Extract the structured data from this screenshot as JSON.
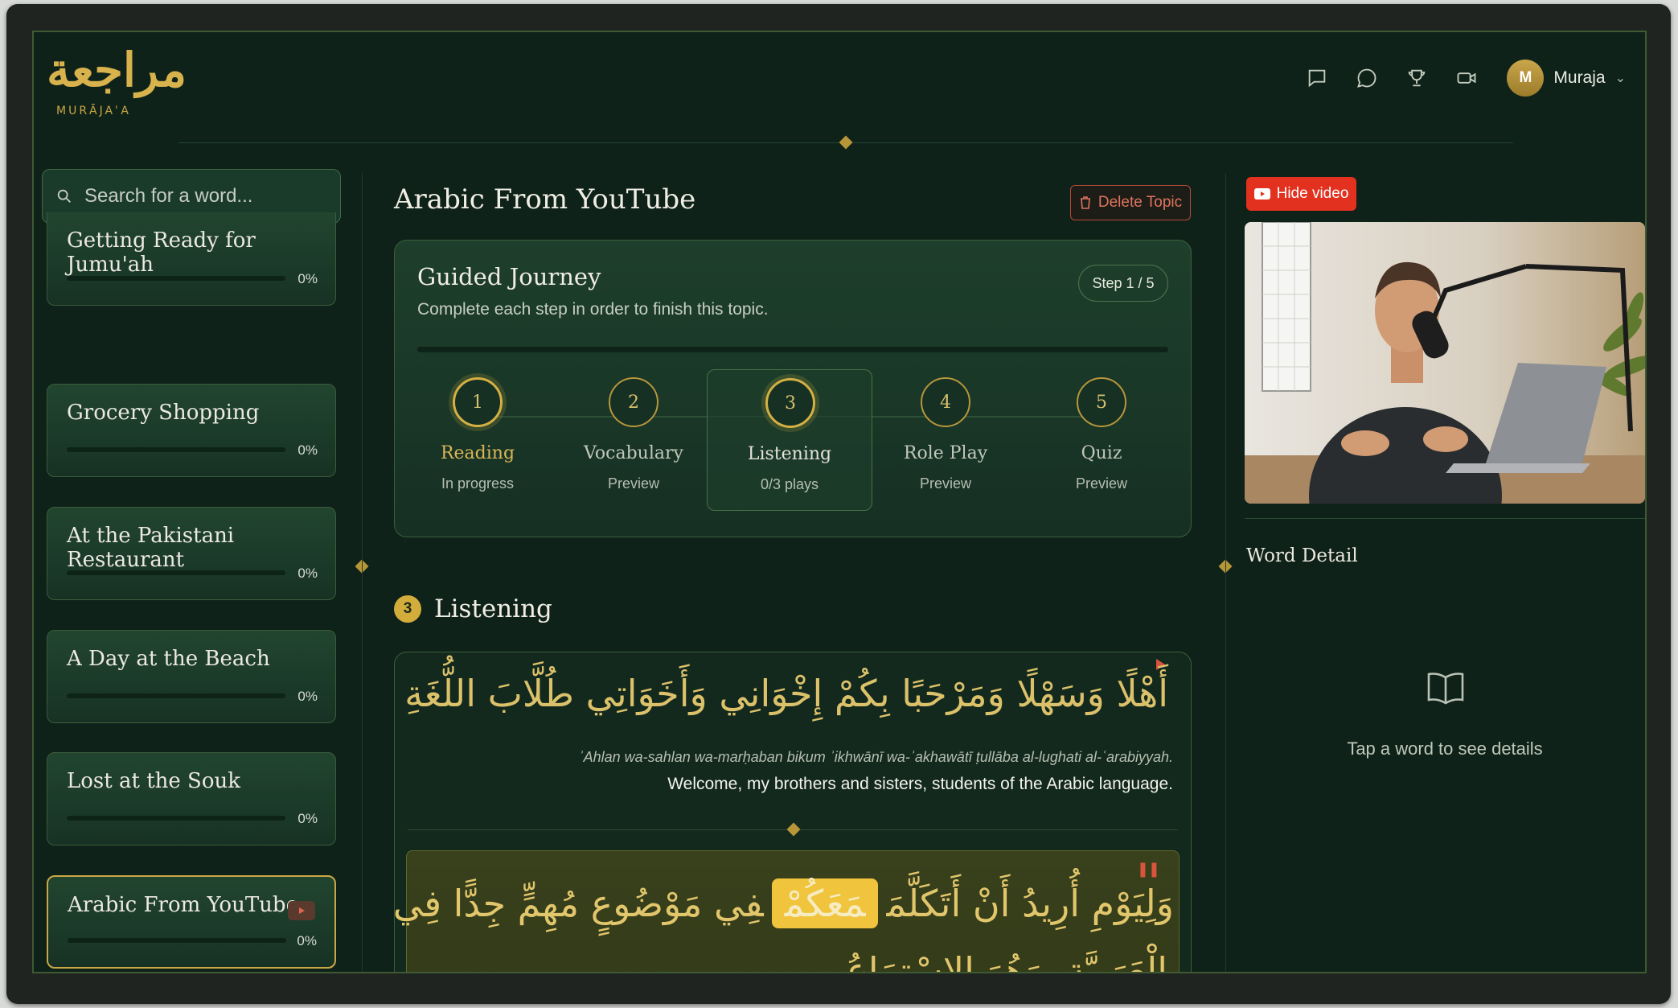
{
  "app": {
    "logo_arabic": "مراجعة",
    "logo_latin": "MURĀJAʿA"
  },
  "header": {
    "user_initial": "M",
    "user_name": "Muraja"
  },
  "sidebar": {
    "search_placeholder": "Search for a word...",
    "topics": [
      {
        "title": "Getting Ready for Jumu'ah",
        "progress": "0%"
      },
      {
        "title": "Grocery Shopping",
        "progress": "0%"
      },
      {
        "title": "At the Pakistani Restaurant",
        "progress": "0%"
      },
      {
        "title": "A Day at the Beach",
        "progress": "0%"
      },
      {
        "title": "Lost at the Souk",
        "progress": "0%"
      },
      {
        "title": "Arabic From YouTube",
        "progress": "0%",
        "active": true
      }
    ]
  },
  "main": {
    "title": "Arabic From YouTube",
    "delete_label": "Delete Topic",
    "journey": {
      "title": "Guided Journey",
      "subtitle": "Complete each step in order to finish this topic.",
      "step_indicator": "Step 1 / 5",
      "steps": [
        {
          "num": "1",
          "name": "Reading",
          "status": "In progress"
        },
        {
          "num": "2",
          "name": "Vocabulary",
          "status": "Preview"
        },
        {
          "num": "3",
          "name": "Listening",
          "status": "0/3 plays"
        },
        {
          "num": "4",
          "name": "Role Play",
          "status": "Preview"
        },
        {
          "num": "5",
          "name": "Quiz",
          "status": "Preview"
        }
      ]
    },
    "section": {
      "number": "3",
      "title": "Listening"
    },
    "listening": {
      "line1_arabic": "أَهْلًا وَسَهْلًا وَمَرْحَبًا بِكُمْ إِخْوَانِي وَأَخَوَاتِي طُلَّابَ اللُّغَةِ الْعَرَبِيَّةِ.",
      "line1_translit": "ʾAhlan wa-sahlan wa-marḥaban bikum ʾikhwānī wa-ʾakhawātī ṭullāba al-lughati al-ʿarabiyyah.",
      "line1_translation": "Welcome, my brothers and sisters, students of the Arabic language.",
      "line2_before": "وَلِيَوْمِ أُرِيدُ أَنْ أَتَكَلَّمَ",
      "line2_highlight": "مَعَكُمْ",
      "line2_after": "فِي مَوْضُوعٍ مُهِمٍّ جِدًّا فِي تَعَلُّمِ اللُّغَةِ",
      "line3": "الْعَرَبِيَّةِ، وَهُوَ الاسْتِمَاعُ."
    }
  },
  "right_panel": {
    "hide_video_label": "Hide video",
    "word_detail_title": "Word Detail",
    "empty_hint": "Tap a word to see details"
  },
  "colors": {
    "accent_gold": "#d4b043",
    "background": "#0f2219",
    "danger": "#e2311e"
  }
}
